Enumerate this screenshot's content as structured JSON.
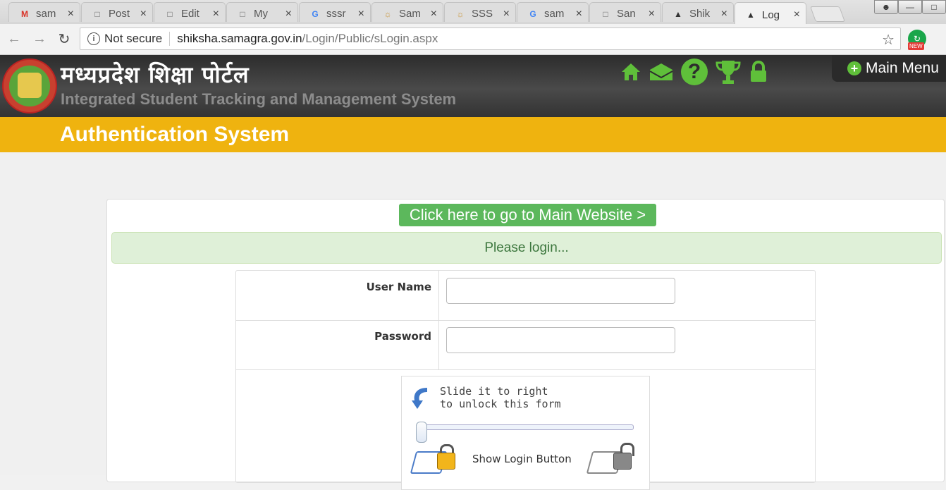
{
  "browser": {
    "tabs": [
      {
        "label": "sam",
        "favicon": "gmail-icon",
        "active": false
      },
      {
        "label": "Post",
        "favicon": "page-icon",
        "active": false
      },
      {
        "label": "Edit",
        "favicon": "page-icon",
        "active": false
      },
      {
        "label": "My",
        "favicon": "page-icon",
        "active": false
      },
      {
        "label": "sssr",
        "favicon": "google-icon",
        "active": false
      },
      {
        "label": "Sam",
        "favicon": "samagra-icon",
        "active": false
      },
      {
        "label": "SSS",
        "favicon": "samagra-icon",
        "active": false
      },
      {
        "label": "sam",
        "favicon": "google-icon",
        "active": false
      },
      {
        "label": "San",
        "favicon": "page-icon",
        "active": false
      },
      {
        "label": "Shik",
        "favicon": "graduation-cap-icon",
        "active": false
      },
      {
        "label": "Log",
        "favicon": "graduation-cap-icon",
        "active": true
      }
    ],
    "security": "Not secure",
    "url_host": "shiksha.samagra.gov.in",
    "url_path": "/Login/Public/sLogin.aspx",
    "extension_badge": "NEW"
  },
  "header": {
    "title": "मध्यप्रदेश शिक्षा पोर्टल",
    "subtitle": "Integrated Student Tracking and Management System",
    "main_menu": "Main Menu",
    "icons": [
      "home-icon",
      "mail-icon",
      "help-icon",
      "trophy-icon",
      "lock-icon"
    ],
    "accent": "#5fbf3a"
  },
  "auth_bar": {
    "title": "Authentication System",
    "color": "#efb30f"
  },
  "main": {
    "website_link": "Click here to go to Main Website >",
    "alert": "Please login...",
    "username_label": "User Name",
    "password_label": "Password",
    "username_value": "",
    "password_value": "",
    "slider_line1": "Slide it to right",
    "slider_line2": "to unlock this form",
    "show_login": "Show Login Button"
  }
}
